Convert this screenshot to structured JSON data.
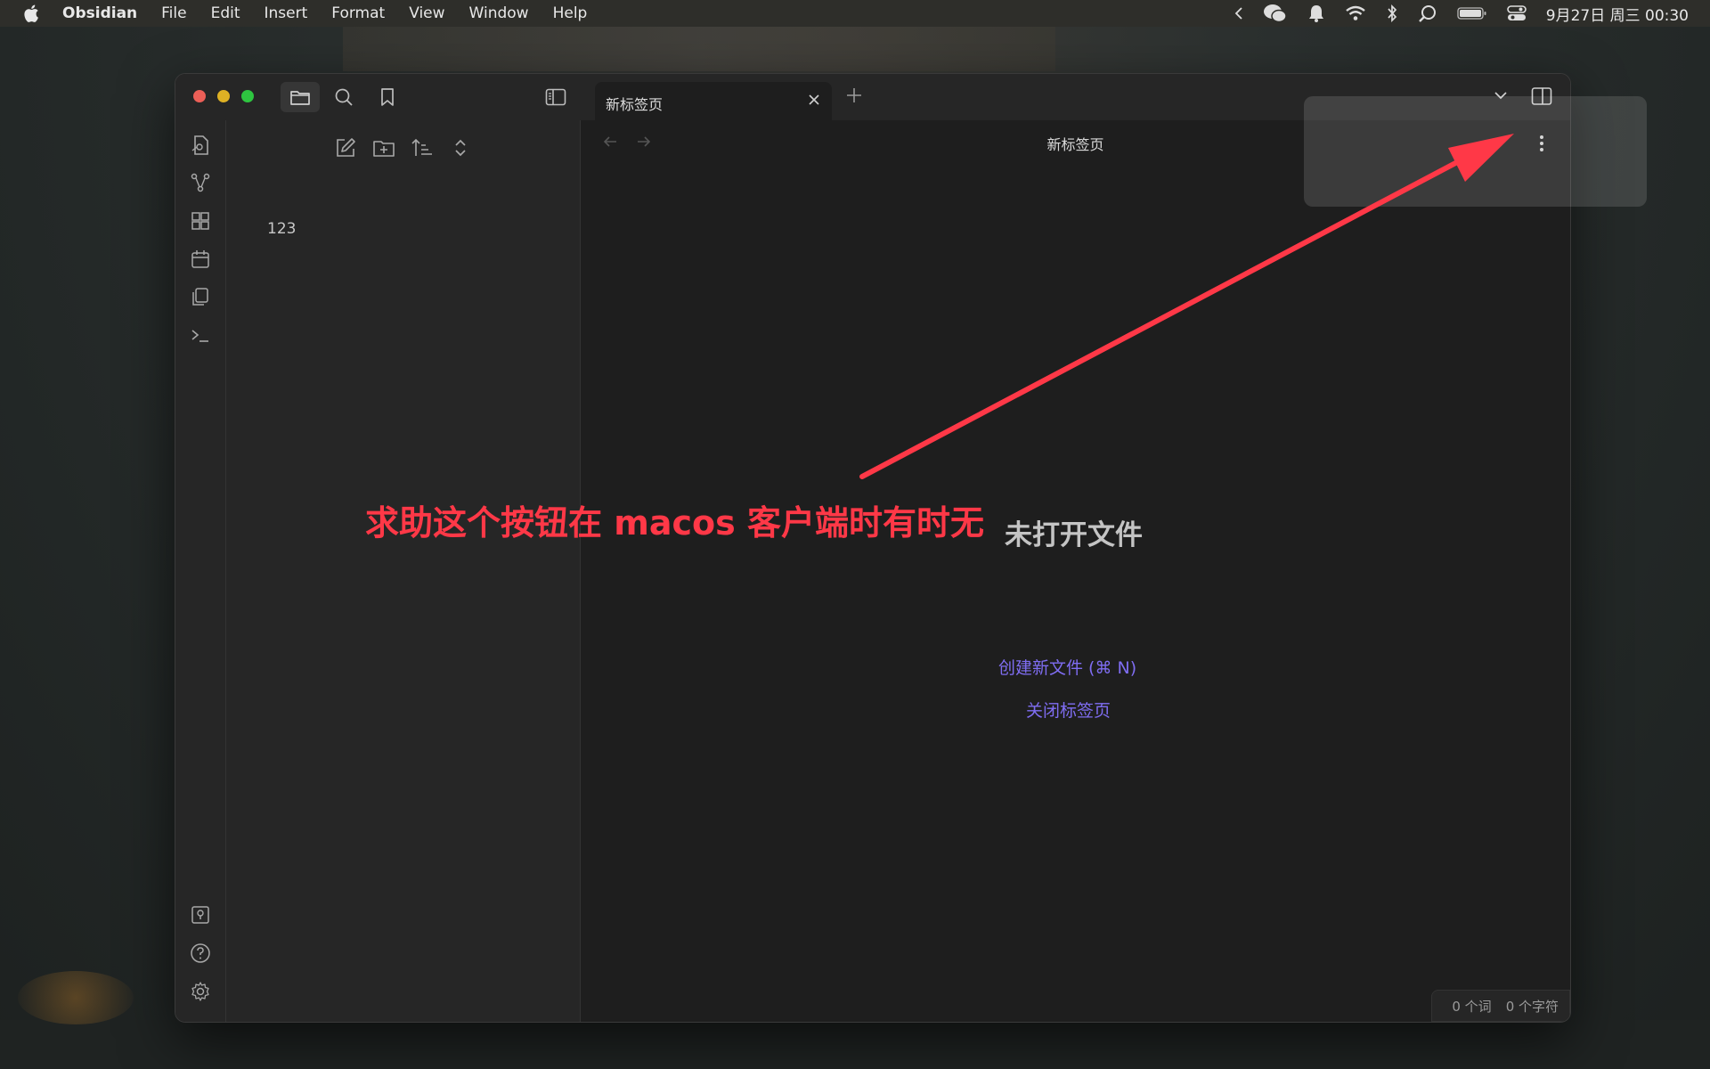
{
  "menubar": {
    "app": "Obsidian",
    "items": [
      "File",
      "Edit",
      "Insert",
      "Format",
      "View",
      "Window",
      "Help"
    ],
    "clock": "9月27日 周三  00:30"
  },
  "window": {
    "tab_title": "新标签页",
    "view_title": "新标签页",
    "file_item": "123",
    "empty_title": "未打开文件",
    "create_link": "创建新文件 (⌘ N)",
    "close_link": "关闭标签页",
    "status_words": "0 个词",
    "status_chars": "0 个字符"
  },
  "annotation": {
    "text": "求助这个按钮在 macos 客户端时有时无",
    "color": "#ff3847"
  },
  "colors": {
    "accent": "#7f6df2",
    "traffic_red": "#ec5f57",
    "traffic_yellow": "#deb124",
    "traffic_green": "#2ec540"
  }
}
